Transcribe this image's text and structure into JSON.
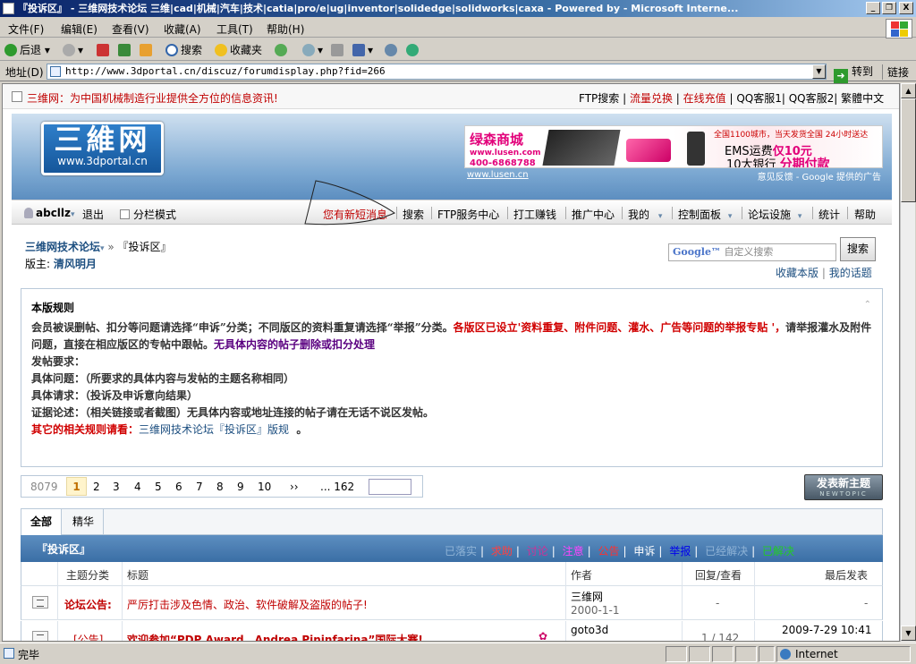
{
  "window": {
    "title": "『投诉区』 - 三维网技术论坛 三维|cad|机械|汽车|技术|catia|pro/e|ug|inventor|solidedge|solidworks|caxa - Powered by  - Microsoft Interne...",
    "minimize": "_",
    "maximize": "❐",
    "close": "X"
  },
  "menu": [
    "文件(F)",
    "编辑(E)",
    "查看(V)",
    "收藏(A)",
    "工具(T)",
    "帮助(H)"
  ],
  "toolbar": {
    "back": "后退",
    "search": "搜索",
    "favorites": "收藏夹"
  },
  "address": {
    "label": "地址(D)",
    "url": "http://www.3dportal.cn/discuz/forumdisplay.php?fid=266",
    "go": "转到",
    "links": "链接"
  },
  "site": {
    "slogan": "三维网：为中国机械制造行业提供全方位的信息资讯!",
    "toplinks": [
      "FTP搜索",
      "流量兑换",
      "在线充值",
      "QQ客服1",
      "QQ客服2",
      "繁體中文"
    ],
    "logo_text": "三維网",
    "logo_url": "www.3dportal.cn"
  },
  "ad": {
    "shop": "绿森商城",
    "site": "www.lusen.com",
    "tel": "400-6868788",
    "line1": "全国1100城市，当天发货全国 24小时送达",
    "line2a": "EMS运费",
    "line2b": "仅10元",
    "line3a": "10大银行",
    "line3b": "分期付款",
    "link": "www.lusen.cn",
    "feedback": "意见反馈 - Google 提供的广告"
  },
  "nav": {
    "user": "abcllz",
    "logout": "退出",
    "split": "分栏模式",
    "newmsg": "您有新短消息",
    "items": [
      "搜索",
      "FTP服务中心",
      "打工赚钱",
      "推广中心",
      "我的",
      "控制面板",
      "论坛设施",
      "统计",
      "帮助"
    ]
  },
  "forum": {
    "home": "三维网技术论坛",
    "sep": "»",
    "current": "『投诉区』",
    "moderator_label": "版主:",
    "moderator": "清风明月",
    "search_placeholder": "自定义搜索",
    "search_button": "搜索",
    "fav": "收藏本版",
    "mytopics": "我的话题"
  },
  "rules": {
    "title": "本版规则",
    "collapse": "⌃",
    "p1a": "会员被误删帖、扣分等问题请选择“申诉”分类；不同版区的资料重复请选择“举报”分类。",
    "p1b": "各版区已设立'资料重复、附件问题、灌水、广告等问题的举报专贴 '，",
    "p1c": "请举报灌水及附件问题，直接在相应版区的专帖中跟帖。",
    "p1d": "无具体内容的帖子删除或扣分处理",
    "l2": "发帖要求：",
    "l3": "具体问题：（所要求的具体内容与发帖的主题名称相同）",
    "l4": "具体请求：（投诉及申诉意向结果）",
    "l5": "证据论述：（相关链接或者截图）无具体内容或地址连接的帖子请在无话不说区发帖。",
    "l6a": "其它的相关规则请看：",
    "l6b": "三维网技术论坛『投诉区』版规",
    "l6c": "。"
  },
  "pager": {
    "total": "8079",
    "current": "1",
    "pages": [
      "2",
      "3",
      "4",
      "5",
      "6",
      "7",
      "8",
      "9",
      "10"
    ],
    "next": "››",
    "last": "... 162"
  },
  "newtopic": {
    "label": "发表新主题",
    "sub": "NEWTOPIC"
  },
  "tabs": [
    "全部",
    "精华"
  ],
  "board": {
    "name": "『投诉区』",
    "types": [
      "已落实",
      "求助",
      "讨论",
      "注意",
      "公告",
      "申诉",
      "举报",
      "已经解决",
      "已解决"
    ]
  },
  "table": {
    "headers": {
      "category": "主题分类",
      "title": "标题",
      "author": "作者",
      "replies": "回复/查看",
      "last": "最后发表"
    },
    "rows": [
      {
        "category": "论坛公告:",
        "title": "严厉打击涉及色情、政治、软件破解及盗版的帖子!",
        "author": "三维网",
        "date": "2000-1-1",
        "replies": "-",
        "last": "-"
      },
      {
        "category": "[公告]",
        "title": "欢迎参加“PDP Award，Andrea Pininfarina”国际大赛!",
        "author": "goto3d",
        "date": "",
        "replies": "1 / 142",
        "last": "2009-7-29 10:41"
      }
    ]
  },
  "status": {
    "text": "完毕",
    "zone": "Internet"
  }
}
